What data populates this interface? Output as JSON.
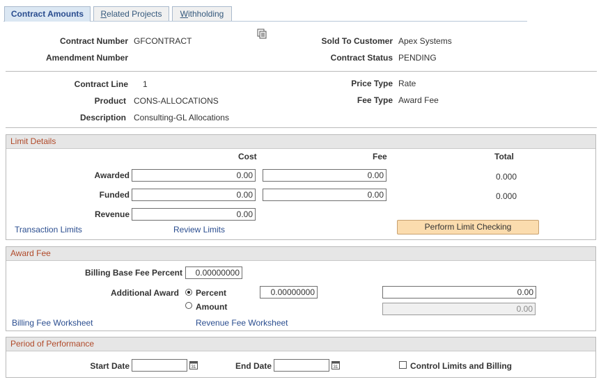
{
  "tabs": [
    {
      "label": "Contract Amounts",
      "ul": "",
      "rest": "Contract Amounts"
    },
    {
      "label": "Related Projects",
      "ul": "R",
      "rest": "elated Projects"
    },
    {
      "label": "Withholding",
      "ul": "W",
      "rest": "ithholding"
    }
  ],
  "header": {
    "contract_number_label": "Contract Number",
    "contract_number": "GFCONTRACT",
    "amendment_number_label": "Amendment Number",
    "amendment_number": "",
    "sold_to_label": "Sold To Customer",
    "sold_to": "Apex Systems",
    "status_label": "Contract Status",
    "status": "PENDING",
    "icon": "document-stack-icon"
  },
  "line": {
    "contract_line_label": "Contract Line",
    "contract_line": "1",
    "product_label": "Product",
    "product": "CONS-ALLOCATIONS",
    "description_label": "Description",
    "description": "Consulting-GL Allocations",
    "price_type_label": "Price Type",
    "price_type": "Rate",
    "fee_type_label": "Fee Type",
    "fee_type": "Award Fee"
  },
  "limit_details": {
    "title": "Limit Details",
    "col_cost": "Cost",
    "col_fee": "Fee",
    "col_total": "Total",
    "awarded_label": "Awarded",
    "awarded_cost": "0.00",
    "awarded_fee": "0.00",
    "awarded_total": "0.000",
    "funded_label": "Funded",
    "funded_cost": "0.00",
    "funded_fee": "0.00",
    "funded_total": "0.000",
    "revenue_label": "Revenue",
    "revenue_cost": "0.00",
    "transaction_limits": "Transaction Limits",
    "review_limits": "Review Limits",
    "perform_button": "Perform Limit Checking"
  },
  "award_fee": {
    "title": "Award Fee",
    "billing_base_label": "Billing Base Fee Percent",
    "billing_base_value": "0.00000000",
    "additional_award_label": "Additional Award",
    "percent_label": "Percent",
    "amount_label": "Amount",
    "percent_value": "0.00000000",
    "percent_amount_value": "0.00",
    "amount_value": "0.00",
    "selected": "Percent",
    "billing_worksheet": "Billing Fee Worksheet",
    "revenue_worksheet": "Revenue Fee Worksheet"
  },
  "period": {
    "title": "Period of Performance",
    "start_label": "Start Date",
    "start_value": "",
    "end_label": "End Date",
    "end_value": "",
    "control_label": "Control Limits and Billing",
    "control_checked": false
  },
  "colors": {
    "accent": "#b04a2a",
    "link": "#2a4d8f",
    "button": "#fbdcae"
  }
}
